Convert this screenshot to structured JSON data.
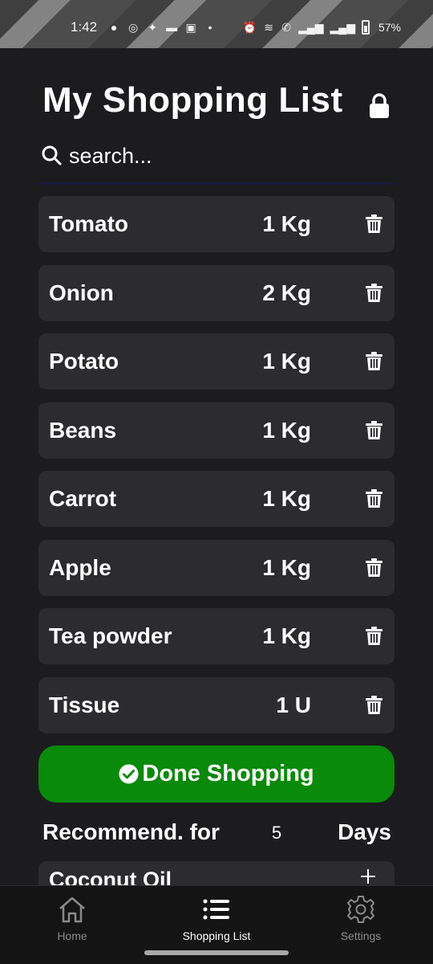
{
  "status_bar": {
    "time": "1:42",
    "battery": "57%",
    "left_icons": [
      "chat-icon",
      "instagram-icon",
      "app-icon",
      "app-icon",
      "linkedin-icon",
      "dot-icon"
    ],
    "right_icons": [
      "alarm-icon",
      "wifi-icon",
      "call-icon",
      "signal-icon",
      "signal-icon",
      "battery-icon"
    ]
  },
  "header": {
    "title": "My Shopping List",
    "lock_icon": "lock-icon"
  },
  "search": {
    "placeholder": "search...",
    "value": ""
  },
  "items": [
    {
      "name": "Tomato",
      "quantity": "1 Kg"
    },
    {
      "name": "Onion",
      "quantity": "2 Kg"
    },
    {
      "name": "Potato",
      "quantity": "1 Kg"
    },
    {
      "name": "Beans",
      "quantity": "1 Kg"
    },
    {
      "name": "Carrot",
      "quantity": "1 Kg"
    },
    {
      "name": "Apple",
      "quantity": "1 Kg"
    },
    {
      "name": "Tea powder",
      "quantity": "1 Kg"
    },
    {
      "name": "Tissue",
      "quantity": "1 U"
    }
  ],
  "done_button": {
    "label": "Done Shopping",
    "color": "#0a8a0a"
  },
  "recommend": {
    "label": "Recommend. for",
    "days_value": "5",
    "unit": "Days",
    "items": [
      {
        "name": "Coconut Oil"
      }
    ]
  },
  "bottom_nav": {
    "items": [
      {
        "label": "Home",
        "icon": "home-icon",
        "active": false
      },
      {
        "label": "Shopping List",
        "icon": "list-icon",
        "active": true
      },
      {
        "label": "Settings",
        "icon": "gear-icon",
        "active": false
      }
    ]
  },
  "colors": {
    "background": "#1c1c1e",
    "card": "#2c2b2e",
    "accent_green": "#0a8a0a",
    "nav_inactive": "#8a8a8a"
  }
}
